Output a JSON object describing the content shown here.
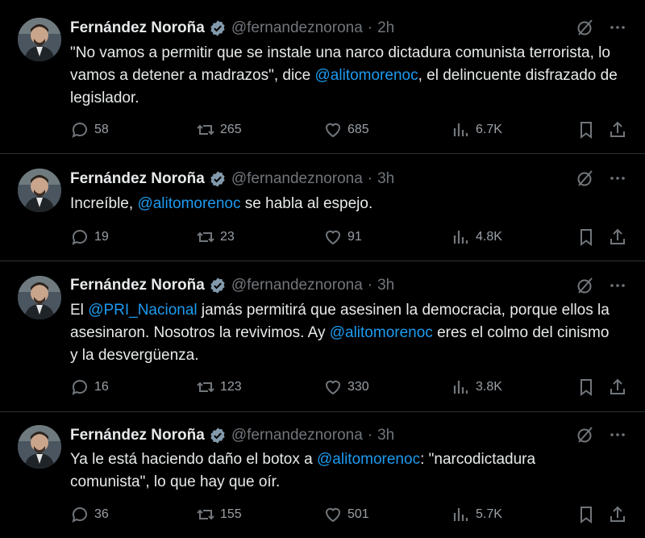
{
  "tweets": [
    {
      "name": "Fernández Noroña",
      "handle": "@fernandeznorona",
      "time": "2h",
      "parts": [
        {
          "t": "\"No vamos a permitir que se instale una narco dictadura comunista terrorista, lo vamos a detener a madrazos\", dice "
        },
        {
          "m": "@alitomorenoc"
        },
        {
          "t": ", el delincuente disfrazado de legislador."
        }
      ],
      "replies": "58",
      "reposts": "265",
      "likes": "685",
      "views": "6.7K"
    },
    {
      "name": "Fernández Noroña",
      "handle": "@fernandeznorona",
      "time": "3h",
      "parts": [
        {
          "t": "Increíble, "
        },
        {
          "m": "@alitomorenoc"
        },
        {
          "t": " se habla al espejo."
        }
      ],
      "replies": "19",
      "reposts": "23",
      "likes": "91",
      "views": "4.8K"
    },
    {
      "name": "Fernández Noroña",
      "handle": "@fernandeznorona",
      "time": "3h",
      "parts": [
        {
          "t": "El "
        },
        {
          "m": "@PRI_Nacional"
        },
        {
          "t": " jamás permitirá que asesinen la democracia, porque ellos la asesinaron. Nosotros la revivimos. Ay "
        },
        {
          "m": "@alitomorenoc"
        },
        {
          "t": " eres el colmo del cinismo y la desvergüenza."
        }
      ],
      "replies": "16",
      "reposts": "123",
      "likes": "330",
      "views": "3.8K"
    },
    {
      "name": "Fernández Noroña",
      "handle": "@fernandeznorona",
      "time": "3h",
      "parts": [
        {
          "t": "Ya le está haciendo daño el botox a "
        },
        {
          "m": "@alitomorenoc"
        },
        {
          "t": ": \"narcodictadura comunista\", lo que hay que oír."
        }
      ],
      "replies": "36",
      "reposts": "155",
      "likes": "501",
      "views": "5.7K"
    }
  ],
  "colors": {
    "background": "#000000",
    "mention": "#1d9bf0",
    "muted": "#71767b",
    "verified": "#829aab"
  },
  "icons": [
    "verified-badge-icon",
    "grok-icon",
    "more-icon",
    "reply-icon",
    "repost-icon",
    "like-icon",
    "views-icon",
    "bookmark-icon",
    "share-icon"
  ]
}
